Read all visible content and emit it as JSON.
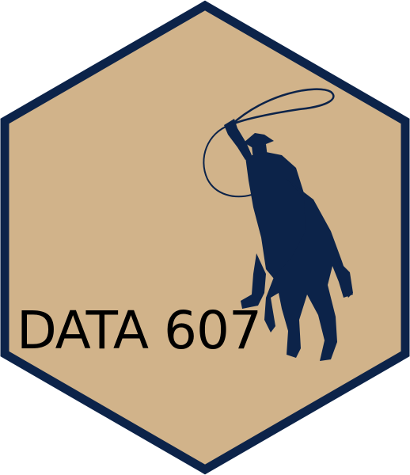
{
  "sticker": {
    "label": "DATA 607",
    "hex_fill_color": "#d1b38a",
    "hex_border_color": "#0c2349",
    "silhouette_color": "#0c2349",
    "label_color": "#000000",
    "graphic": "cowboy-on-horse-with-lasso-silhouette"
  }
}
